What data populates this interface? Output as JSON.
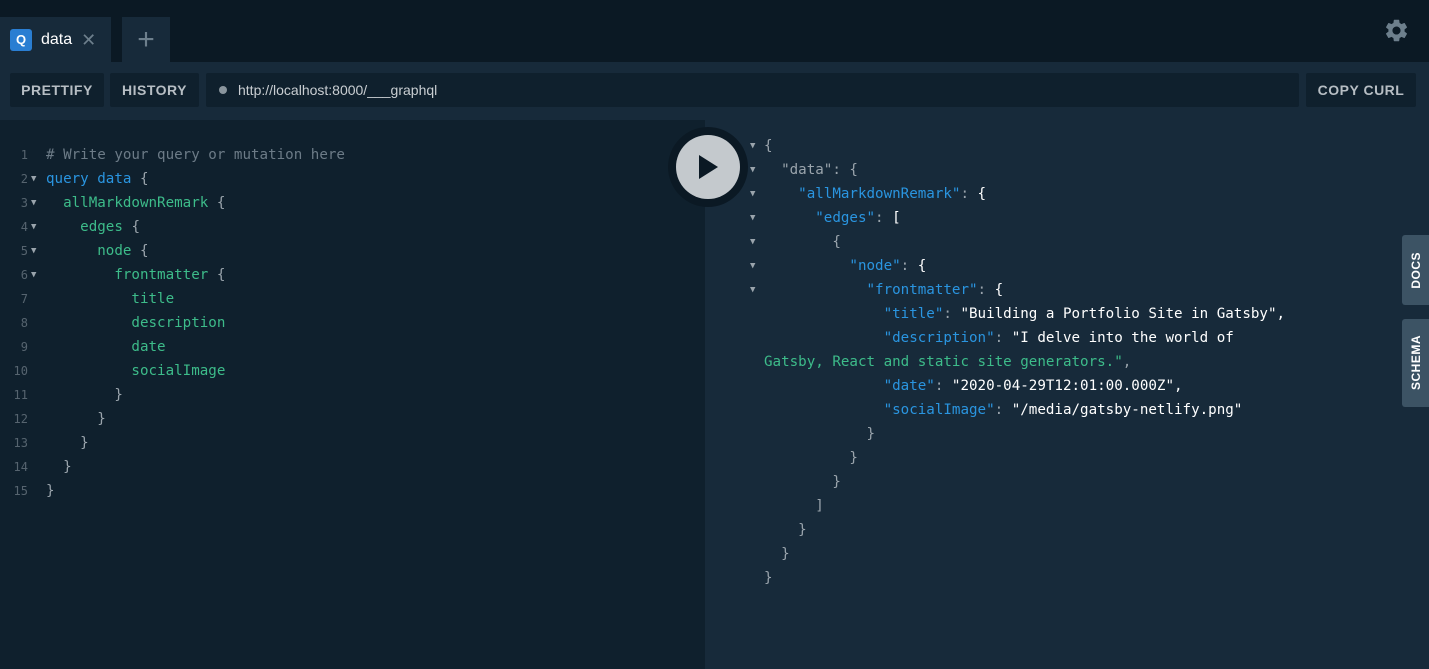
{
  "tabs": [
    {
      "icon": "Q",
      "label": "data",
      "close": "✕"
    }
  ],
  "add_tab": "+",
  "toolbar": {
    "prettify": "PRETTIFY",
    "history": "HISTORY",
    "url": "http://localhost:8000/___graphql",
    "copy_curl": "COPY CURL"
  },
  "editor": {
    "line_numbers": [
      "1",
      "2",
      "3",
      "4",
      "5",
      "6",
      "7",
      "8",
      "9",
      "10",
      "11",
      "12",
      "13",
      "14",
      "15"
    ],
    "lines": [
      "# Write your query or mutation here",
      "query data {",
      "  allMarkdownRemark {",
      "    edges {",
      "      node {",
      "        frontmatter {",
      "          title",
      "          description",
      "          date",
      "          socialImage",
      "        }",
      "      }",
      "    }",
      "  }",
      "}"
    ]
  },
  "result": {
    "lines": [
      "{",
      "  \"data\": {",
      "    \"allMarkdownRemark\": {",
      "      \"edges\": [",
      "        {",
      "          \"node\": {",
      "            \"frontmatter\": {",
      "              \"title\": \"Building a Portfolio Site in Gatsby\",",
      "              \"description\": \"I delve into the world of",
      "Gatsby, React and static site generators.\",",
      "              \"date\": \"2020-04-29T12:01:00.000Z\",",
      "              \"socialImage\": \"/media/gatsby-netlify.png\"",
      "            }",
      "          }",
      "        }",
      "      ]",
      "    }",
      "  }",
      "}"
    ]
  },
  "side_tabs": {
    "docs": "DOCS",
    "schema": "SCHEMA"
  },
  "icons": {
    "settings": "gear-icon",
    "run": "play-icon",
    "close": "close-icon",
    "add": "plus-icon"
  },
  "colors": {
    "background": "#0f202d",
    "panel": "#172a3a",
    "keyword": "#2a95e0",
    "field": "#3dbc8a",
    "comment": "#6c7b87",
    "tab_icon": "#2a7ed2"
  }
}
